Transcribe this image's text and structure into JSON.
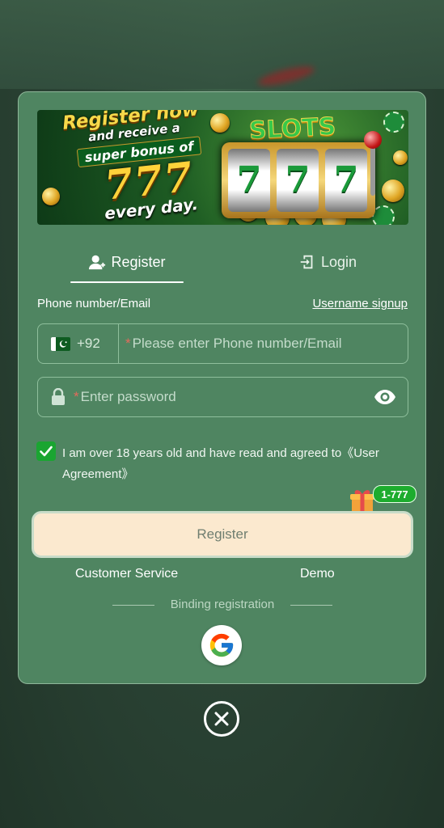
{
  "banner": {
    "line1": "Register now",
    "line2": "and receive a",
    "line3": "super bonus of",
    "amount": "777",
    "line5": "every day.",
    "slots": "SLOTS",
    "reel_symbol": "7"
  },
  "tabs": [
    {
      "label": "Register",
      "icon": "user-add-icon",
      "active": true
    },
    {
      "label": "Login",
      "icon": "login-door-icon",
      "active": false
    }
  ],
  "form": {
    "phone_label": "Phone number/Email",
    "username_signup": "Username signup",
    "country_code": "+92",
    "phone_placeholder": "Please enter Phone number/Email",
    "password_placeholder": "Enter password",
    "required_mark": "*"
  },
  "agreement": {
    "checked": true,
    "text": "I am over 18 years old and have read and agreed to《User Agreement》"
  },
  "bonus_badge": "1-777",
  "register_button": "Register",
  "links": {
    "customer_service": "Customer Service",
    "demo": "Demo"
  },
  "binding_label": "Binding registration",
  "colors": {
    "modal_bg": "#4f8561",
    "button_bg": "#fbe9cf",
    "check_green": "#1aa531",
    "required_red": "#e36a5c"
  }
}
